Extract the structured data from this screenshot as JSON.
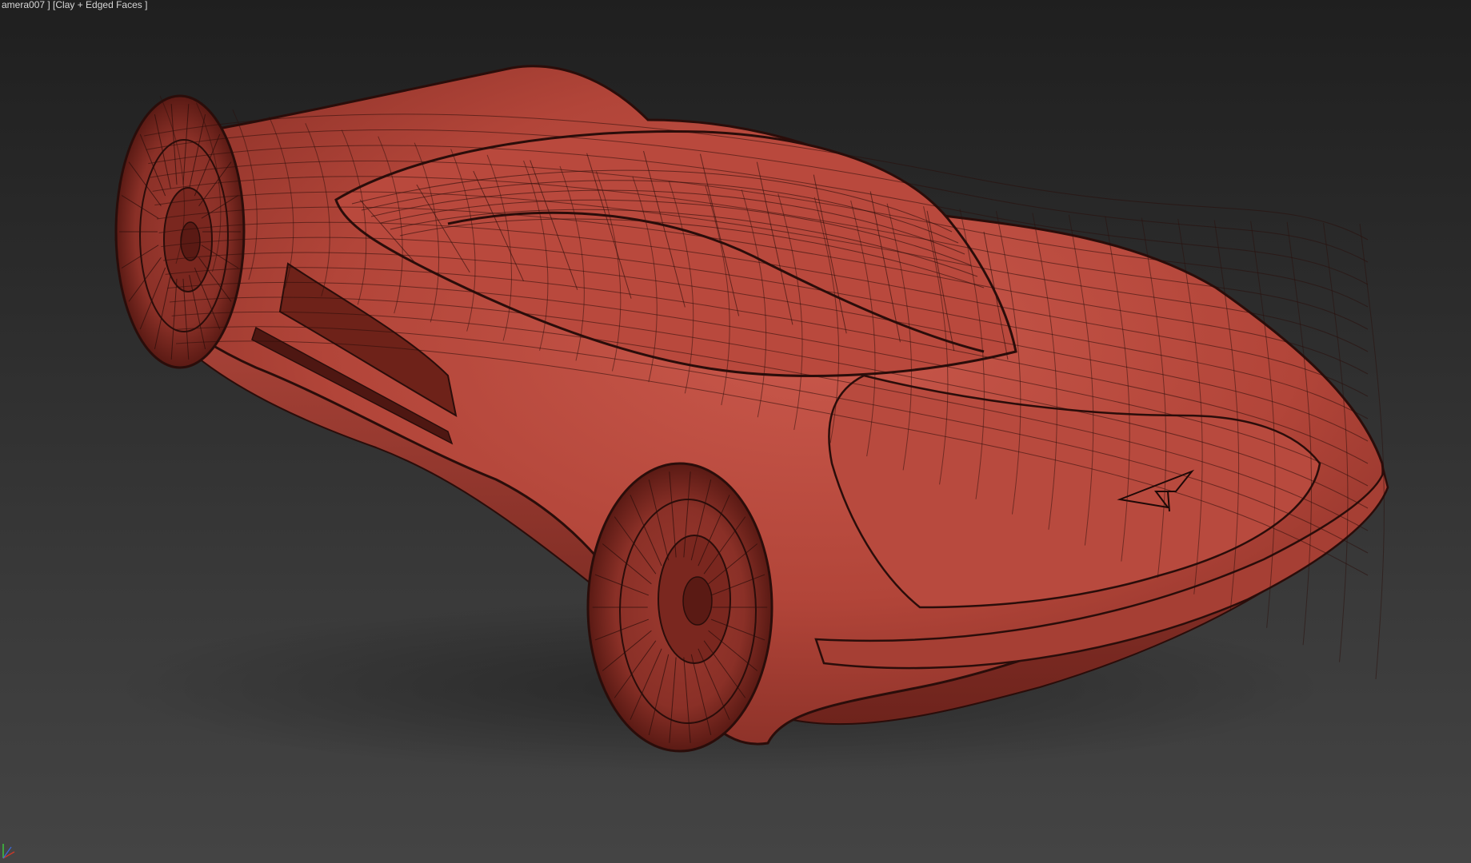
{
  "viewport": {
    "label": "amera007 ] [Clay + Edged Faces ]",
    "shading_mode": "Clay + Edged Faces",
    "background_color_top": "#1f1f1f",
    "background_color_bottom": "#444444",
    "clay_color": "#b8473c",
    "wire_color": "#2a0d0a"
  },
  "scene": {
    "object": "car-model"
  },
  "gizmo": {
    "x_axis_color": "#c83a2a",
    "y_axis_color": "#3cc43c",
    "z_axis_color": "#3a6adc"
  }
}
